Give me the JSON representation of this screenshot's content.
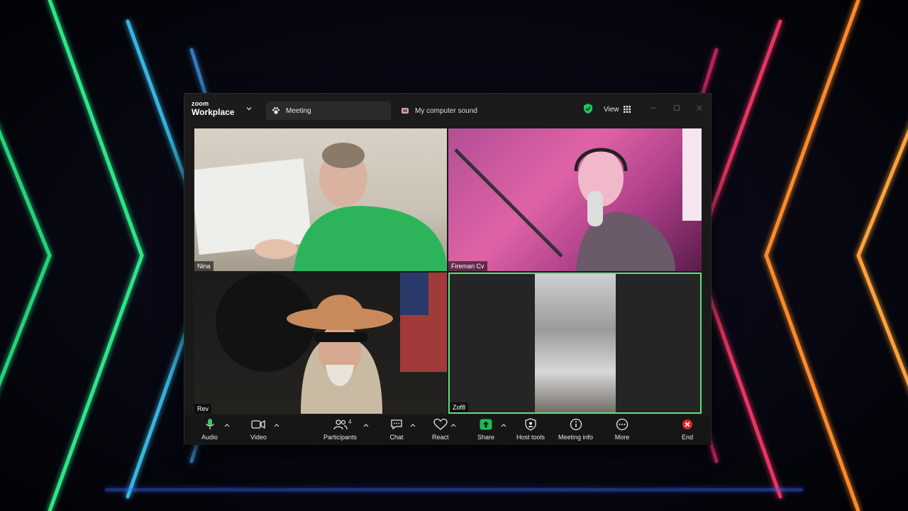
{
  "window": {
    "brand_top": "zoom",
    "brand_name": "Workplace",
    "tabs": [
      {
        "label": "Meeting"
      },
      {
        "label": "My computer sound"
      }
    ],
    "view_label": "View"
  },
  "participants": [
    {
      "name": "Nina"
    },
    {
      "name": "Fireman Cv"
    },
    {
      "name": "Rev"
    },
    {
      "name": "Zof8"
    }
  ],
  "toolbar": {
    "audio": "Audio",
    "video": "Video",
    "participants": "Participants",
    "participants_count": "4",
    "chat": "Chat",
    "react": "React",
    "share": "Share",
    "host_tools": "Host tools",
    "meeting_info": "Meeting info",
    "more": "More",
    "end": "End"
  },
  "colors": {
    "active_speaker": "#5ee07a",
    "share_green": "#1db954",
    "end_red": "#e0242c",
    "mic_green": "#35c759"
  }
}
